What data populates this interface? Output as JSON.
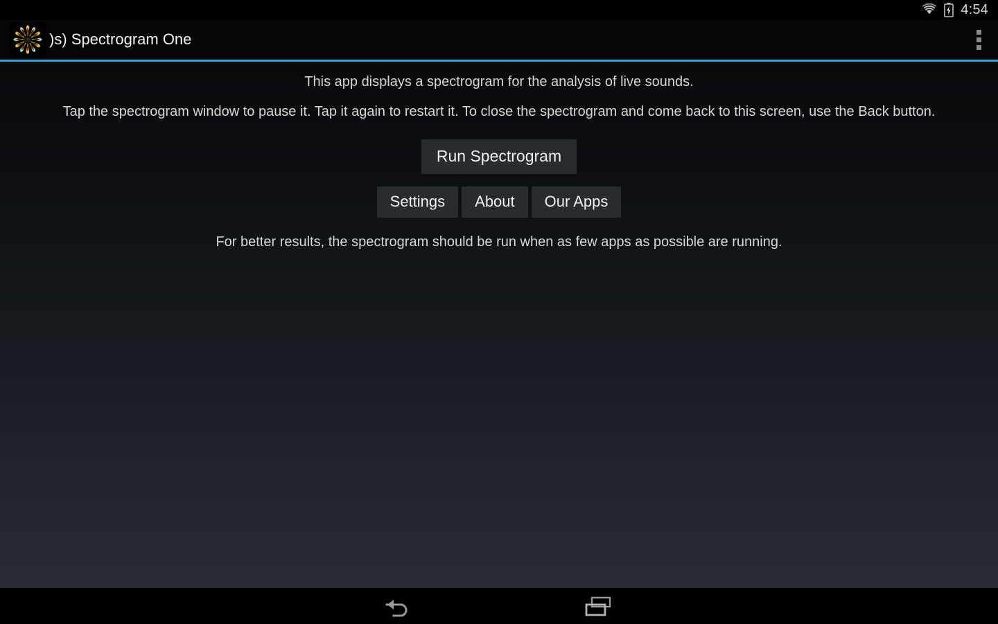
{
  "status_bar": {
    "wifi_icon": "wifi-icon",
    "battery_icon": "battery-charging-icon",
    "clock": "4:54"
  },
  "action_bar": {
    "app_icon": "spectrogram-burst-icon",
    "title": ")s) Spectrogram One",
    "overflow_icon": "overflow-menu-icon"
  },
  "theme": {
    "accent": "#2ba6dd",
    "action_bar_bg": "#050607",
    "button_bg": "#282b2f",
    "text": "#d6d6d6"
  },
  "content": {
    "description_1": "This app displays a spectrogram for the analysis of live sounds.",
    "description_2": "Tap the spectrogram window to pause it. Tap it again to restart it. To close the spectrogram and come back to this screen, use the Back button.",
    "primary_button": "Run Spectrogram",
    "secondary_buttons": [
      {
        "label": "Settings"
      },
      {
        "label": "About"
      },
      {
        "label": "Our Apps"
      }
    ],
    "description_3": "For better results, the spectrogram should be run when as few apps as possible are running."
  },
  "nav_bar": {
    "back_icon": "back-arrow-icon",
    "recents_icon": "recents-icon"
  }
}
